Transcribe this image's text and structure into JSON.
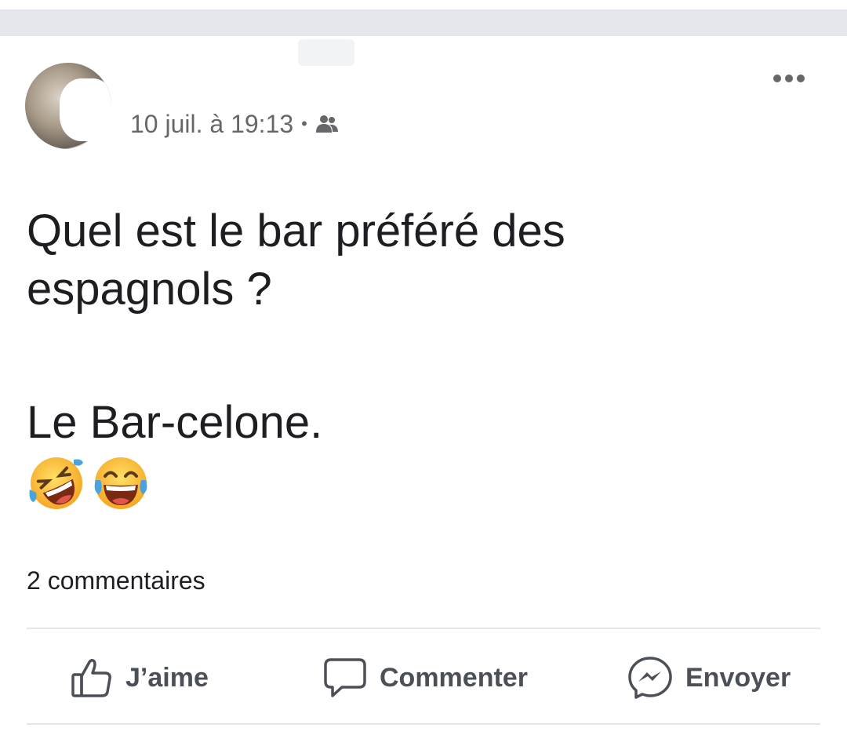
{
  "post": {
    "timestamp": "10 juil. à 19:13",
    "separator": "•",
    "audience_icon": "friends-icon",
    "text_lines": [
      "Quel est le bar préféré des",
      "espagnols ?"
    ],
    "punchline": "Le Bar-celone.",
    "emojis": [
      "rolling-on-floor-laughing-emoji",
      "face-with-tears-of-joy-emoji"
    ]
  },
  "stats": {
    "comments": "2 commentaires"
  },
  "actions": {
    "like_label": "J’aime",
    "comment_label": "Commenter",
    "send_label": "Envoyer"
  },
  "colors": {
    "text": "#1c1e21",
    "secondary": "#65676b",
    "action": "#4b4f56",
    "divider": "#e4e6eb"
  }
}
